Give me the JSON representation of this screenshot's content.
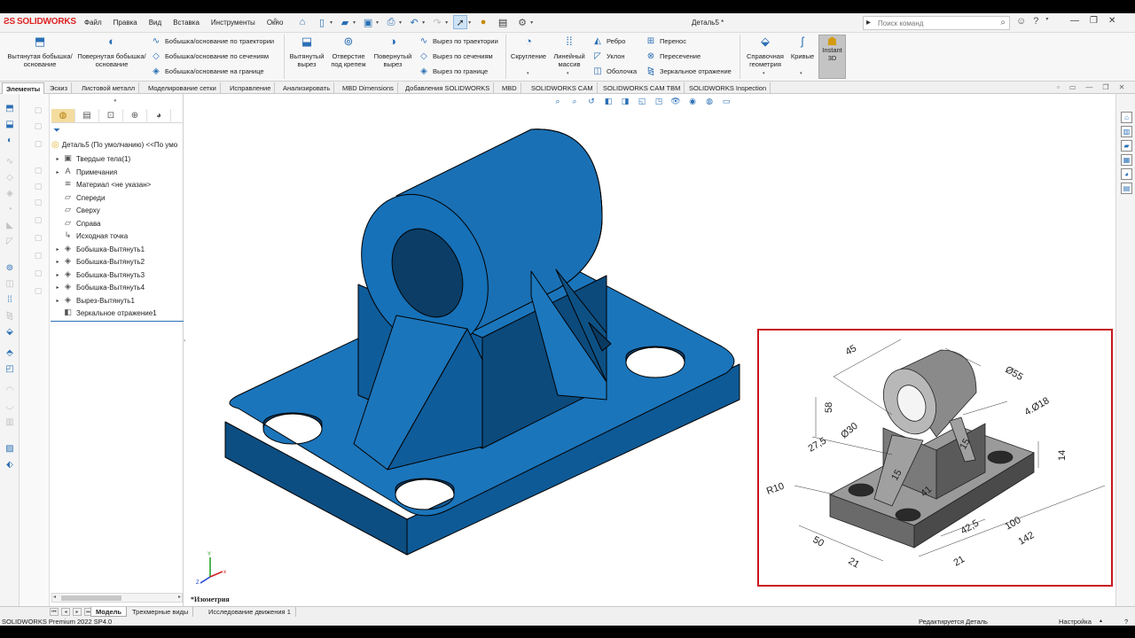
{
  "app": {
    "logo_text": "SOLIDWORKS",
    "menus": [
      "Файл",
      "Правка",
      "Вид",
      "Вставка",
      "Инструменты",
      "Окно"
    ],
    "document_title": "Деталь5 *",
    "search_placeholder": "Поиск команд"
  },
  "ribbon": {
    "extrude_boss": "Вытянутая бобышка/основание",
    "revolve_boss": "Повернутая бобышка/основание",
    "sweep_boss": "Бобышка/основание по траектории",
    "loft_boss": "Бобышка/основание по сечениям",
    "boundary_boss": "Бобышка/основание на границе",
    "extrude_cut": "Вытянутый вырез",
    "hole_wizard": "Отверстие под крепеж",
    "revolve_cut": "Повернутый вырез",
    "sweep_cut": "Вырез по траектории",
    "loft_cut": "Вырез по сечениям",
    "boundary_cut": "Вырез по границе",
    "fillet": "Скругление",
    "linear_pattern": "Линейный массив",
    "rib": "Ребро",
    "draft": "Уклон",
    "shell": "Оболочка",
    "wrap": "Перенос",
    "intersect": "Пересечение",
    "mirror": "Зеркальное отражение",
    "ref_geometry": "Справочная геометрия",
    "curves": "Кривые",
    "instant3d": "Instant 3D"
  },
  "tabs": [
    "Элементы",
    "Эскиз",
    "Листовой металл",
    "Моделирование сетки",
    "Исправление",
    "Анализировать",
    "MBD Dimensions",
    "Добавления SOLIDWORKS",
    "MBD",
    "SOLIDWORKS CAM",
    "SOLIDWORKS CAM TBM",
    "SOLIDWORKS Inspection"
  ],
  "tree": {
    "root": "Деталь5 (По умолчанию) <<По умо",
    "items": [
      {
        "label": "Твердые тела(1)",
        "expand": "▸",
        "icon": "▣"
      },
      {
        "label": "Примечания",
        "expand": "▸",
        "icon": "A"
      },
      {
        "label": "Материал <не указан>",
        "expand": "",
        "icon": "≋"
      },
      {
        "label": "Спереди",
        "expand": "",
        "icon": "▱"
      },
      {
        "label": "Сверху",
        "expand": "",
        "icon": "▱"
      },
      {
        "label": "Справа",
        "expand": "",
        "icon": "▱"
      },
      {
        "label": "Исходная точка",
        "expand": "",
        "icon": "↳"
      },
      {
        "label": "Бобышка-Вытянуть1",
        "expand": "▸",
        "icon": "◈"
      },
      {
        "label": "Бобышка-Вытянуть2",
        "expand": "▸",
        "icon": "◈"
      },
      {
        "label": "Бобышка-Вытянуть3",
        "expand": "▸",
        "icon": "◈"
      },
      {
        "label": "Бобышка-Вытянуть4",
        "expand": "▸",
        "icon": "◈"
      },
      {
        "label": "Вырез-Вытянуть1",
        "expand": "▸",
        "icon": "◈"
      },
      {
        "label": "Зеркальное отражение1",
        "expand": "",
        "icon": "◧"
      }
    ]
  },
  "graphics": {
    "view_label": "*Изометрия",
    "triad": {
      "x": "x",
      "y": "Y",
      "z": "Z"
    },
    "model_color": "#1b75bb",
    "reference_dims": [
      "45",
      "Ø55",
      "58",
      "4.Ø18",
      "Ø30",
      "27,5",
      "14",
      "R10",
      "15",
      "15",
      "41",
      "50",
      "21",
      "42,5",
      "21",
      "100",
      "142"
    ]
  },
  "bottom_tabs": [
    "Модель",
    "Трехмерные виды",
    "Исследование движения 1"
  ],
  "status": {
    "product": "SOLIDWORKS Premium 2022 SP4.0",
    "editing": "Редактируется Деталь",
    "settings": "Настройка"
  }
}
